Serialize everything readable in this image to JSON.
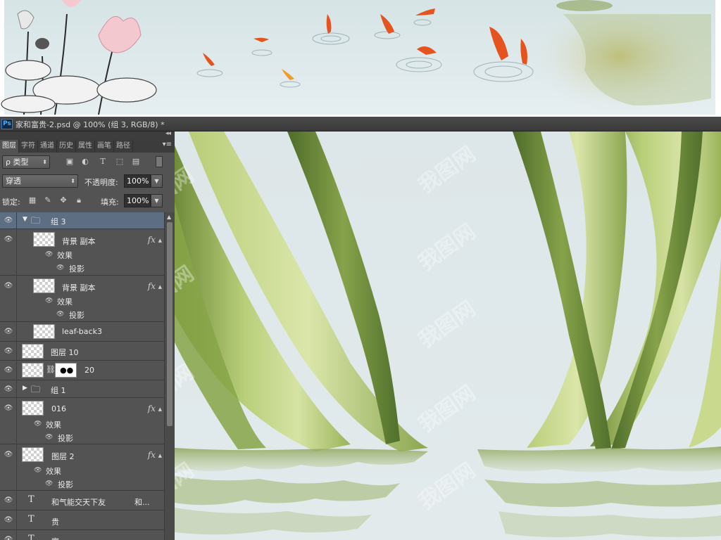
{
  "banner": {
    "description_icons": [
      "lotus-icon",
      "goldfish-icon",
      "ripple-icon"
    ]
  },
  "window": {
    "app_icon_label": "Ps",
    "document_title": "家和富贵-2.psd @ 100% (组 3, RGB/8) *"
  },
  "panel": {
    "collapse_glyph": "◂◂",
    "tabs": [
      "图层",
      "字符",
      "通道",
      "历史",
      "属性",
      "画笔",
      "路径"
    ],
    "menu_glyph": "▾≡",
    "filter": {
      "value": "ρ 类型"
    },
    "blend_mode": "穿透",
    "opacity_label": "不透明度:",
    "opacity_value": "100%",
    "lock_label": "锁定:",
    "fill_label": "填充:",
    "fill_value": "100%"
  },
  "layers": [
    {
      "name": "组 3",
      "type": "group-open",
      "selected": true
    },
    {
      "name": "背景 副本",
      "type": "layer",
      "fx": "fx",
      "effects_label": "效果",
      "effect": "投影"
    },
    {
      "name": "背景 副本",
      "type": "layer",
      "fx": "fx",
      "effects_label": "效果",
      "effect": "投影"
    },
    {
      "name": "leaf-back3",
      "type": "layer"
    },
    {
      "name": "图层 10",
      "type": "layer"
    },
    {
      "name": "20",
      "type": "masked-layer"
    },
    {
      "name": "组 1",
      "type": "group-closed"
    },
    {
      "name": "016",
      "type": "layer",
      "fx": "fx",
      "effects_label": "效果",
      "effect": "投影"
    },
    {
      "name": "图层 2",
      "type": "layer",
      "fx": "fx",
      "effects_label": "效果",
      "effect": "投影"
    },
    {
      "name": "和气能交天下友",
      "extra": "和...",
      "type": "text",
      "icon": "T"
    },
    {
      "name": "贵",
      "type": "text",
      "icon": "T"
    },
    {
      "name": "富",
      "type": "text",
      "icon": "T"
    }
  ],
  "canvas": {
    "watermark": "我图网"
  },
  "colors": {
    "panel_bg": "#535353",
    "selected_row": "#5d6d82",
    "leaf_green": "#9cb85a",
    "water": "#dfe7e9"
  }
}
